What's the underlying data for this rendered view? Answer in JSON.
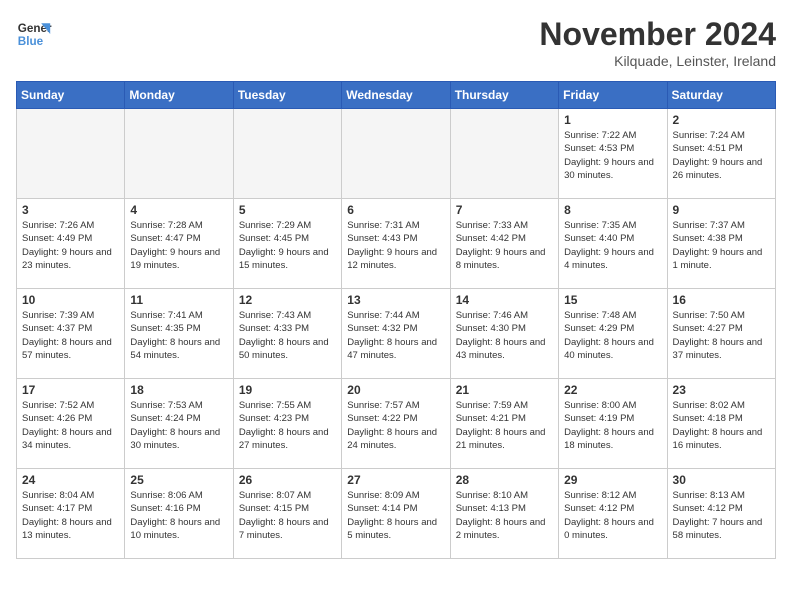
{
  "header": {
    "logo_line1": "General",
    "logo_line2": "Blue",
    "month_title": "November 2024",
    "location": "Kilquade, Leinster, Ireland"
  },
  "days_of_week": [
    "Sunday",
    "Monday",
    "Tuesday",
    "Wednesday",
    "Thursday",
    "Friday",
    "Saturday"
  ],
  "weeks": [
    [
      {
        "day": null
      },
      {
        "day": null
      },
      {
        "day": null
      },
      {
        "day": null
      },
      {
        "day": null
      },
      {
        "day": 1,
        "sunrise": "Sunrise: 7:22 AM",
        "sunset": "Sunset: 4:53 PM",
        "daylight": "Daylight: 9 hours and 30 minutes."
      },
      {
        "day": 2,
        "sunrise": "Sunrise: 7:24 AM",
        "sunset": "Sunset: 4:51 PM",
        "daylight": "Daylight: 9 hours and 26 minutes."
      }
    ],
    [
      {
        "day": 3,
        "sunrise": "Sunrise: 7:26 AM",
        "sunset": "Sunset: 4:49 PM",
        "daylight": "Daylight: 9 hours and 23 minutes."
      },
      {
        "day": 4,
        "sunrise": "Sunrise: 7:28 AM",
        "sunset": "Sunset: 4:47 PM",
        "daylight": "Daylight: 9 hours and 19 minutes."
      },
      {
        "day": 5,
        "sunrise": "Sunrise: 7:29 AM",
        "sunset": "Sunset: 4:45 PM",
        "daylight": "Daylight: 9 hours and 15 minutes."
      },
      {
        "day": 6,
        "sunrise": "Sunrise: 7:31 AM",
        "sunset": "Sunset: 4:43 PM",
        "daylight": "Daylight: 9 hours and 12 minutes."
      },
      {
        "day": 7,
        "sunrise": "Sunrise: 7:33 AM",
        "sunset": "Sunset: 4:42 PM",
        "daylight": "Daylight: 9 hours and 8 minutes."
      },
      {
        "day": 8,
        "sunrise": "Sunrise: 7:35 AM",
        "sunset": "Sunset: 4:40 PM",
        "daylight": "Daylight: 9 hours and 4 minutes."
      },
      {
        "day": 9,
        "sunrise": "Sunrise: 7:37 AM",
        "sunset": "Sunset: 4:38 PM",
        "daylight": "Daylight: 9 hours and 1 minute."
      }
    ],
    [
      {
        "day": 10,
        "sunrise": "Sunrise: 7:39 AM",
        "sunset": "Sunset: 4:37 PM",
        "daylight": "Daylight: 8 hours and 57 minutes."
      },
      {
        "day": 11,
        "sunrise": "Sunrise: 7:41 AM",
        "sunset": "Sunset: 4:35 PM",
        "daylight": "Daylight: 8 hours and 54 minutes."
      },
      {
        "day": 12,
        "sunrise": "Sunrise: 7:43 AM",
        "sunset": "Sunset: 4:33 PM",
        "daylight": "Daylight: 8 hours and 50 minutes."
      },
      {
        "day": 13,
        "sunrise": "Sunrise: 7:44 AM",
        "sunset": "Sunset: 4:32 PM",
        "daylight": "Daylight: 8 hours and 47 minutes."
      },
      {
        "day": 14,
        "sunrise": "Sunrise: 7:46 AM",
        "sunset": "Sunset: 4:30 PM",
        "daylight": "Daylight: 8 hours and 43 minutes."
      },
      {
        "day": 15,
        "sunrise": "Sunrise: 7:48 AM",
        "sunset": "Sunset: 4:29 PM",
        "daylight": "Daylight: 8 hours and 40 minutes."
      },
      {
        "day": 16,
        "sunrise": "Sunrise: 7:50 AM",
        "sunset": "Sunset: 4:27 PM",
        "daylight": "Daylight: 8 hours and 37 minutes."
      }
    ],
    [
      {
        "day": 17,
        "sunrise": "Sunrise: 7:52 AM",
        "sunset": "Sunset: 4:26 PM",
        "daylight": "Daylight: 8 hours and 34 minutes."
      },
      {
        "day": 18,
        "sunrise": "Sunrise: 7:53 AM",
        "sunset": "Sunset: 4:24 PM",
        "daylight": "Daylight: 8 hours and 30 minutes."
      },
      {
        "day": 19,
        "sunrise": "Sunrise: 7:55 AM",
        "sunset": "Sunset: 4:23 PM",
        "daylight": "Daylight: 8 hours and 27 minutes."
      },
      {
        "day": 20,
        "sunrise": "Sunrise: 7:57 AM",
        "sunset": "Sunset: 4:22 PM",
        "daylight": "Daylight: 8 hours and 24 minutes."
      },
      {
        "day": 21,
        "sunrise": "Sunrise: 7:59 AM",
        "sunset": "Sunset: 4:21 PM",
        "daylight": "Daylight: 8 hours and 21 minutes."
      },
      {
        "day": 22,
        "sunrise": "Sunrise: 8:00 AM",
        "sunset": "Sunset: 4:19 PM",
        "daylight": "Daylight: 8 hours and 18 minutes."
      },
      {
        "day": 23,
        "sunrise": "Sunrise: 8:02 AM",
        "sunset": "Sunset: 4:18 PM",
        "daylight": "Daylight: 8 hours and 16 minutes."
      }
    ],
    [
      {
        "day": 24,
        "sunrise": "Sunrise: 8:04 AM",
        "sunset": "Sunset: 4:17 PM",
        "daylight": "Daylight: 8 hours and 13 minutes."
      },
      {
        "day": 25,
        "sunrise": "Sunrise: 8:06 AM",
        "sunset": "Sunset: 4:16 PM",
        "daylight": "Daylight: 8 hours and 10 minutes."
      },
      {
        "day": 26,
        "sunrise": "Sunrise: 8:07 AM",
        "sunset": "Sunset: 4:15 PM",
        "daylight": "Daylight: 8 hours and 7 minutes."
      },
      {
        "day": 27,
        "sunrise": "Sunrise: 8:09 AM",
        "sunset": "Sunset: 4:14 PM",
        "daylight": "Daylight: 8 hours and 5 minutes."
      },
      {
        "day": 28,
        "sunrise": "Sunrise: 8:10 AM",
        "sunset": "Sunset: 4:13 PM",
        "daylight": "Daylight: 8 hours and 2 minutes."
      },
      {
        "day": 29,
        "sunrise": "Sunrise: 8:12 AM",
        "sunset": "Sunset: 4:12 PM",
        "daylight": "Daylight: 8 hours and 0 minutes."
      },
      {
        "day": 30,
        "sunrise": "Sunrise: 8:13 AM",
        "sunset": "Sunset: 4:12 PM",
        "daylight": "Daylight: 7 hours and 58 minutes."
      }
    ]
  ]
}
